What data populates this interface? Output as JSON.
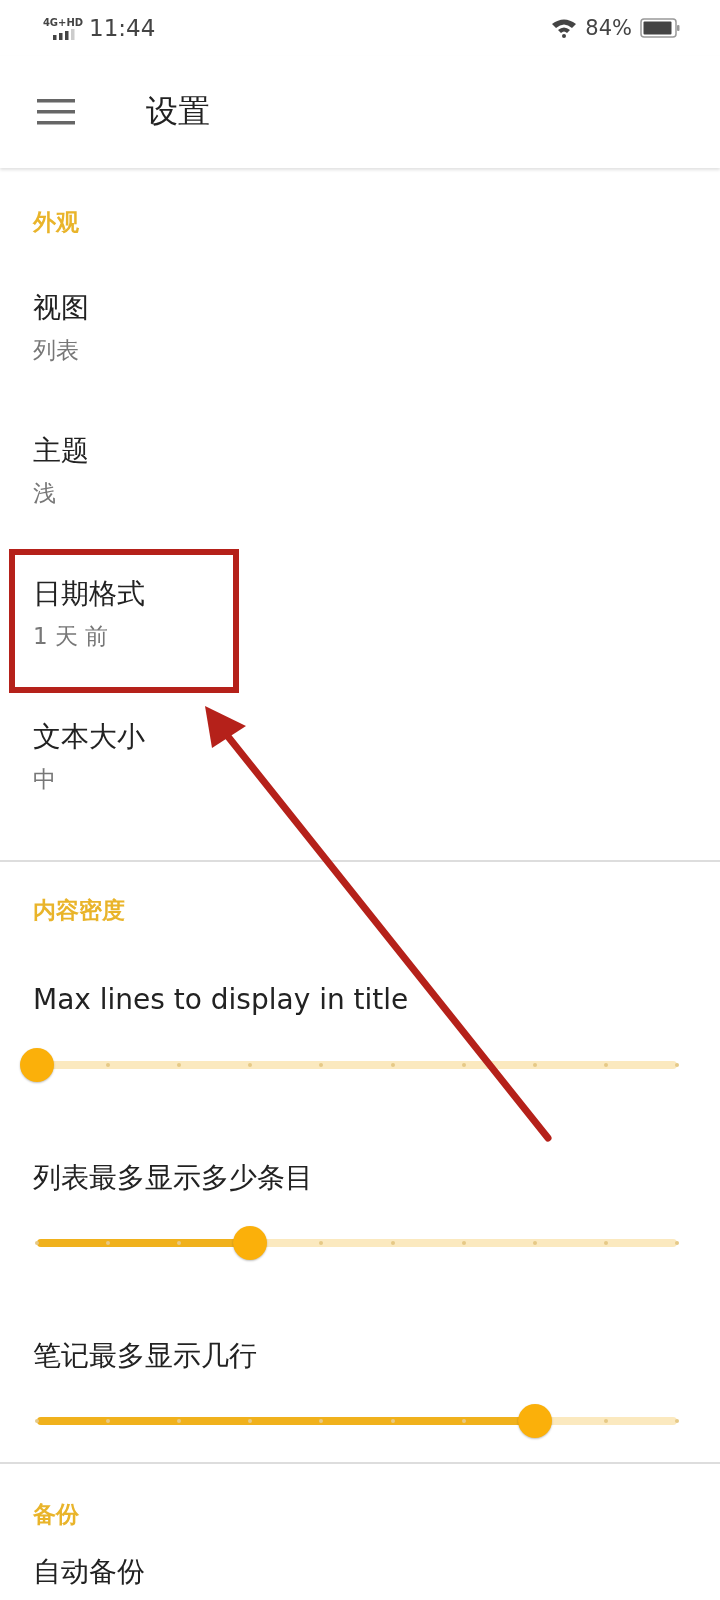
{
  "status_bar": {
    "network": "4G+HD",
    "time": "11:44",
    "battery": "84%"
  },
  "app_bar": {
    "title": "设置"
  },
  "sections": [
    {
      "header": "外观",
      "items": [
        {
          "kind": "value",
          "title": "视图",
          "value": "列表"
        },
        {
          "kind": "value",
          "title": "主题",
          "value": "浅"
        },
        {
          "kind": "value",
          "title": "日期格式",
          "value": "1 天 前"
        },
        {
          "kind": "value",
          "title": "文本大小",
          "value": "中"
        }
      ]
    },
    {
      "header": "内容密度",
      "items": [
        {
          "kind": "slider",
          "title": "Max lines to display in title",
          "level": 0
        },
        {
          "kind": "slider",
          "title": "列表最多显示多少条目",
          "level": 0.333
        },
        {
          "kind": "slider",
          "title": "笔记最多显示几行",
          "level": 0.778
        }
      ]
    },
    {
      "header": "备份",
      "items": [
        {
          "kind": "value",
          "title": "自动备份"
        }
      ]
    }
  ]
}
